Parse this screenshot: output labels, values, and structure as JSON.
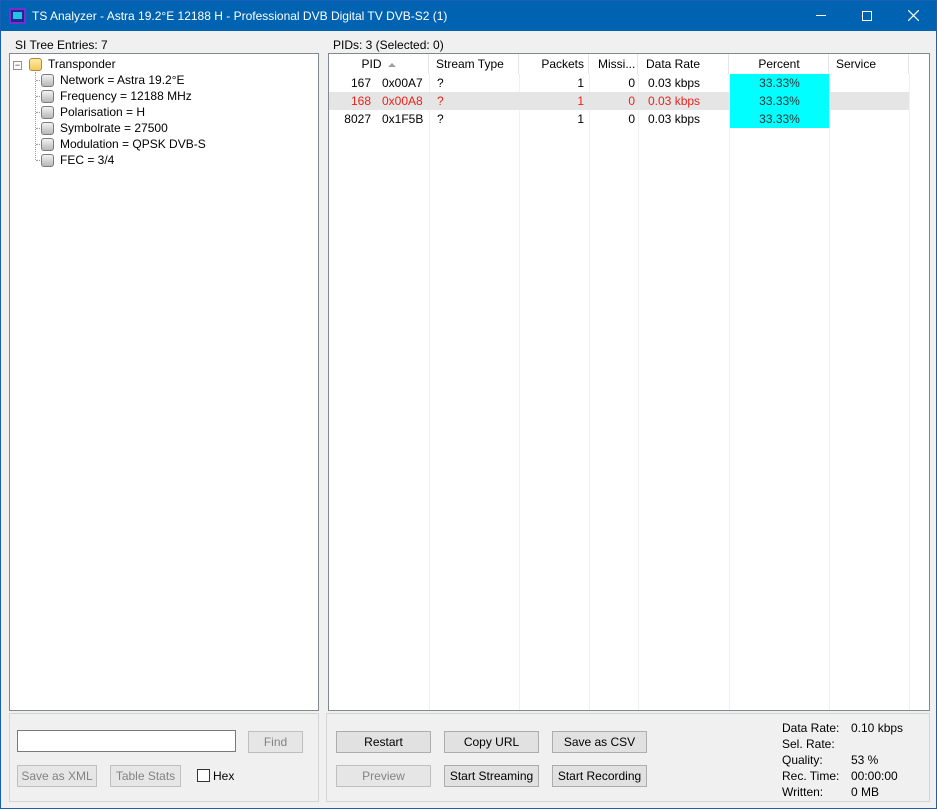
{
  "window": {
    "title": "TS Analyzer - Astra 19.2°E 12188 H - Professional DVB Digital TV DVB-S2 (1)"
  },
  "si_tree": {
    "header": "SI Tree Entries: 7",
    "root": {
      "label": "Transponder",
      "expander": "−"
    },
    "children": [
      {
        "label": "Network = Astra 19.2°E"
      },
      {
        "label": "Frequency = 12188 MHz"
      },
      {
        "label": "Polarisation = H"
      },
      {
        "label": "Symbolrate = 27500"
      },
      {
        "label": "Modulation = QPSK DVB-S"
      },
      {
        "label": "FEC = 3/4"
      }
    ]
  },
  "left_controls": {
    "search_value": "",
    "find_label": "Find",
    "save_xml_label": "Save as XML",
    "table_stats_label": "Table Stats",
    "hex_label": "Hex"
  },
  "pid_table": {
    "header": "PIDs: 3   (Selected: 0)",
    "columns": [
      "PID",
      "Stream Type",
      "Packets",
      "Missi...",
      "Data Rate",
      "Percent",
      "Service"
    ],
    "rows": [
      {
        "pid": "167",
        "hex": "0x00A7",
        "stream_type": "?",
        "packets": "1",
        "missing": "0",
        "data_rate": "0.03 kbps",
        "percent": "33.33%",
        "service": ""
      },
      {
        "pid": "168",
        "hex": "0x00A8",
        "stream_type": "?",
        "packets": "1",
        "missing": "0",
        "data_rate": "0.03 kbps",
        "percent": "33.33%",
        "service": ""
      },
      {
        "pid": "8027",
        "hex": "0x1F5B",
        "stream_type": "?",
        "packets": "1",
        "missing": "0",
        "data_rate": "0.03 kbps",
        "percent": "33.33%",
        "service": ""
      }
    ],
    "selected_row_color": "#e8231b",
    "percent_bar_color": "#00ffff"
  },
  "right_controls": {
    "restart_label": "Restart",
    "copy_url_label": "Copy URL",
    "save_csv_label": "Save as CSV",
    "preview_label": "Preview",
    "start_streaming_label": "Start Streaming",
    "start_recording_label": "Start Recording"
  },
  "stats": {
    "data_rate_label": "Data Rate:",
    "data_rate_value": "0.10 kbps",
    "sel_rate_label": "Sel. Rate:",
    "sel_rate_value": "",
    "quality_label": "Quality:",
    "quality_value": "53 %",
    "rec_time_label": "Rec. Time:",
    "rec_time_value": "00:00:00",
    "written_label": "Written:",
    "written_value": "0 MB"
  },
  "colors": {
    "titlebar": "#0063b1",
    "accent": "#00ffff"
  }
}
